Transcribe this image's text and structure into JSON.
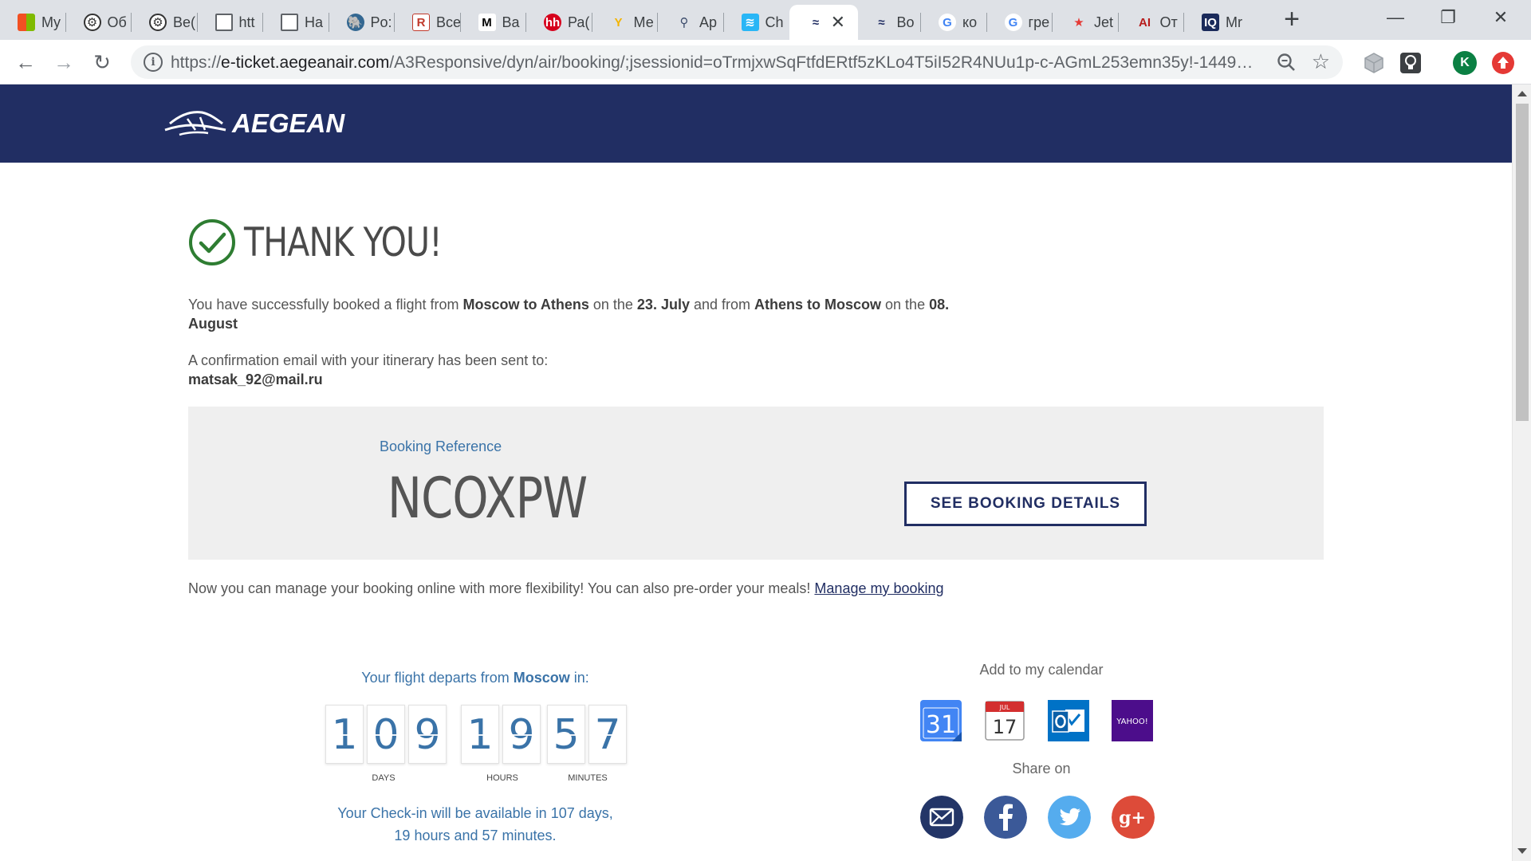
{
  "browser": {
    "tabs": [
      {
        "label": "My",
        "icon": "ms-icon"
      },
      {
        "label": "Об",
        "icon": "openai-icon"
      },
      {
        "label": "Ве(",
        "icon": "openai-icon"
      },
      {
        "label": "htt",
        "icon": "page-icon"
      },
      {
        "label": "На",
        "icon": "page-icon"
      },
      {
        "label": "Po:",
        "icon": "postgres-icon"
      },
      {
        "label": "Все",
        "icon": "doc-icon"
      },
      {
        "label": "Ва",
        "icon": "m-icon"
      },
      {
        "label": "Ра(",
        "icon": "hh-icon"
      },
      {
        "label": "Ме",
        "icon": "ymaps-icon"
      },
      {
        "label": "Ар",
        "icon": "pin-icon"
      },
      {
        "label": "Ch",
        "icon": "wifi-icon"
      },
      {
        "label": "",
        "icon": "aegean-icon"
      },
      {
        "label": "Во",
        "icon": "aegean-icon"
      },
      {
        "label": "ко",
        "icon": "google-icon"
      },
      {
        "label": "гре",
        "icon": "google-icon"
      },
      {
        "label": "Jet",
        "icon": "star-icon"
      },
      {
        "label": "От",
        "icon": "ai-icon"
      },
      {
        "label": "Mr",
        "icon": "iq-icon"
      }
    ],
    "new_tab": "+",
    "url_scheme": "https://",
    "url_host": "e-ticket.aegeanair.com",
    "url_path": "/A3Responsive/dyn/air/booking/;jsessionid=oTrmjxwSqFtfdERtf5zKLo4T5iI52R4NUu1p-c-AGmL253emn35y!-144993...",
    "profile_initial": "K"
  },
  "header": {
    "logo_text": "AEGEAN"
  },
  "confirmation": {
    "title": "THANK YOU!",
    "p1_a": "You have successfully booked a flight from ",
    "p1_b": "Moscow to Athens",
    "p1_c": " on the ",
    "p1_d": "23. July",
    "p1_e": " and from ",
    "p1_f": "Athens to Moscow",
    "p1_g": " on the ",
    "p1_h": "08. August",
    "p2_a": "A confirmation email with your itinerary has been sent to:",
    "email": "matsak_92@mail.ru"
  },
  "booking": {
    "label": "Booking Reference",
    "code": "NCOXPW",
    "details_button": "SEE BOOKING DETAILS"
  },
  "manage": {
    "text": "Now you can manage your booking online with more flexibility! You can also pre-order your meals! ",
    "link": "Manage my booking"
  },
  "countdown": {
    "title_a": "Your flight departs from ",
    "title_b": "Moscow",
    "title_c": " in:",
    "days": [
      "1",
      "0",
      "9"
    ],
    "hours": [
      "1",
      "9"
    ],
    "minutes": [
      "5",
      "7"
    ],
    "days_label": "DAYS",
    "hours_label": "HOURS",
    "minutes_label": "MINUTES",
    "checkin_line1": "Your Check-in will be available in 107 days,",
    "checkin_line2": "19 hours and 57 minutes."
  },
  "calendar": {
    "title": "Add to my calendar",
    "google_day": "31",
    "apple_month": "JUL",
    "apple_day": "17",
    "yahoo_label": "YAHOO!"
  },
  "share": {
    "title": "Share on"
  },
  "colors": {
    "brand_navy": "#212e63",
    "accent_blue": "#3a73a8",
    "check_green": "#2e7d32"
  }
}
